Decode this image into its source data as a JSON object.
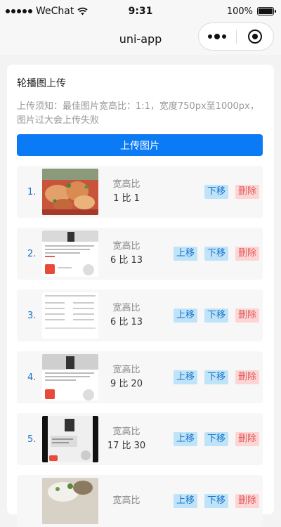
{
  "status_bar": {
    "carrier": "WeChat",
    "time": "9:31",
    "battery": "100%",
    "battery_level": 1.0
  },
  "nav": {
    "title": "uni-app"
  },
  "card": {
    "title": "轮播图上传",
    "notice": "上传须知：最佳图片宽高比：1:1，宽度750px至1000px，图片过大会上传失败",
    "upload_label": "上传图片"
  },
  "labels": {
    "ratio": "宽高比",
    "move_up": "上移",
    "move_down": "下移",
    "delete": "删除"
  },
  "items": [
    {
      "index": "1.",
      "ratio": "1 比 1"
    },
    {
      "index": "2.",
      "ratio": "6 比 13"
    },
    {
      "index": "3.",
      "ratio": "6 比 13"
    },
    {
      "index": "4.",
      "ratio": "9 比 20"
    },
    {
      "index": "5.",
      "ratio": "17 比 30"
    },
    {
      "index": "",
      "ratio": ""
    }
  ],
  "colors": {
    "primary": "#0a7af5",
    "index_text": "#1a73c8",
    "blue_btn_bg": "#bfe3f8",
    "red_btn_bg": "#fdd5d5",
    "red_btn_text": "#e05a5a"
  }
}
